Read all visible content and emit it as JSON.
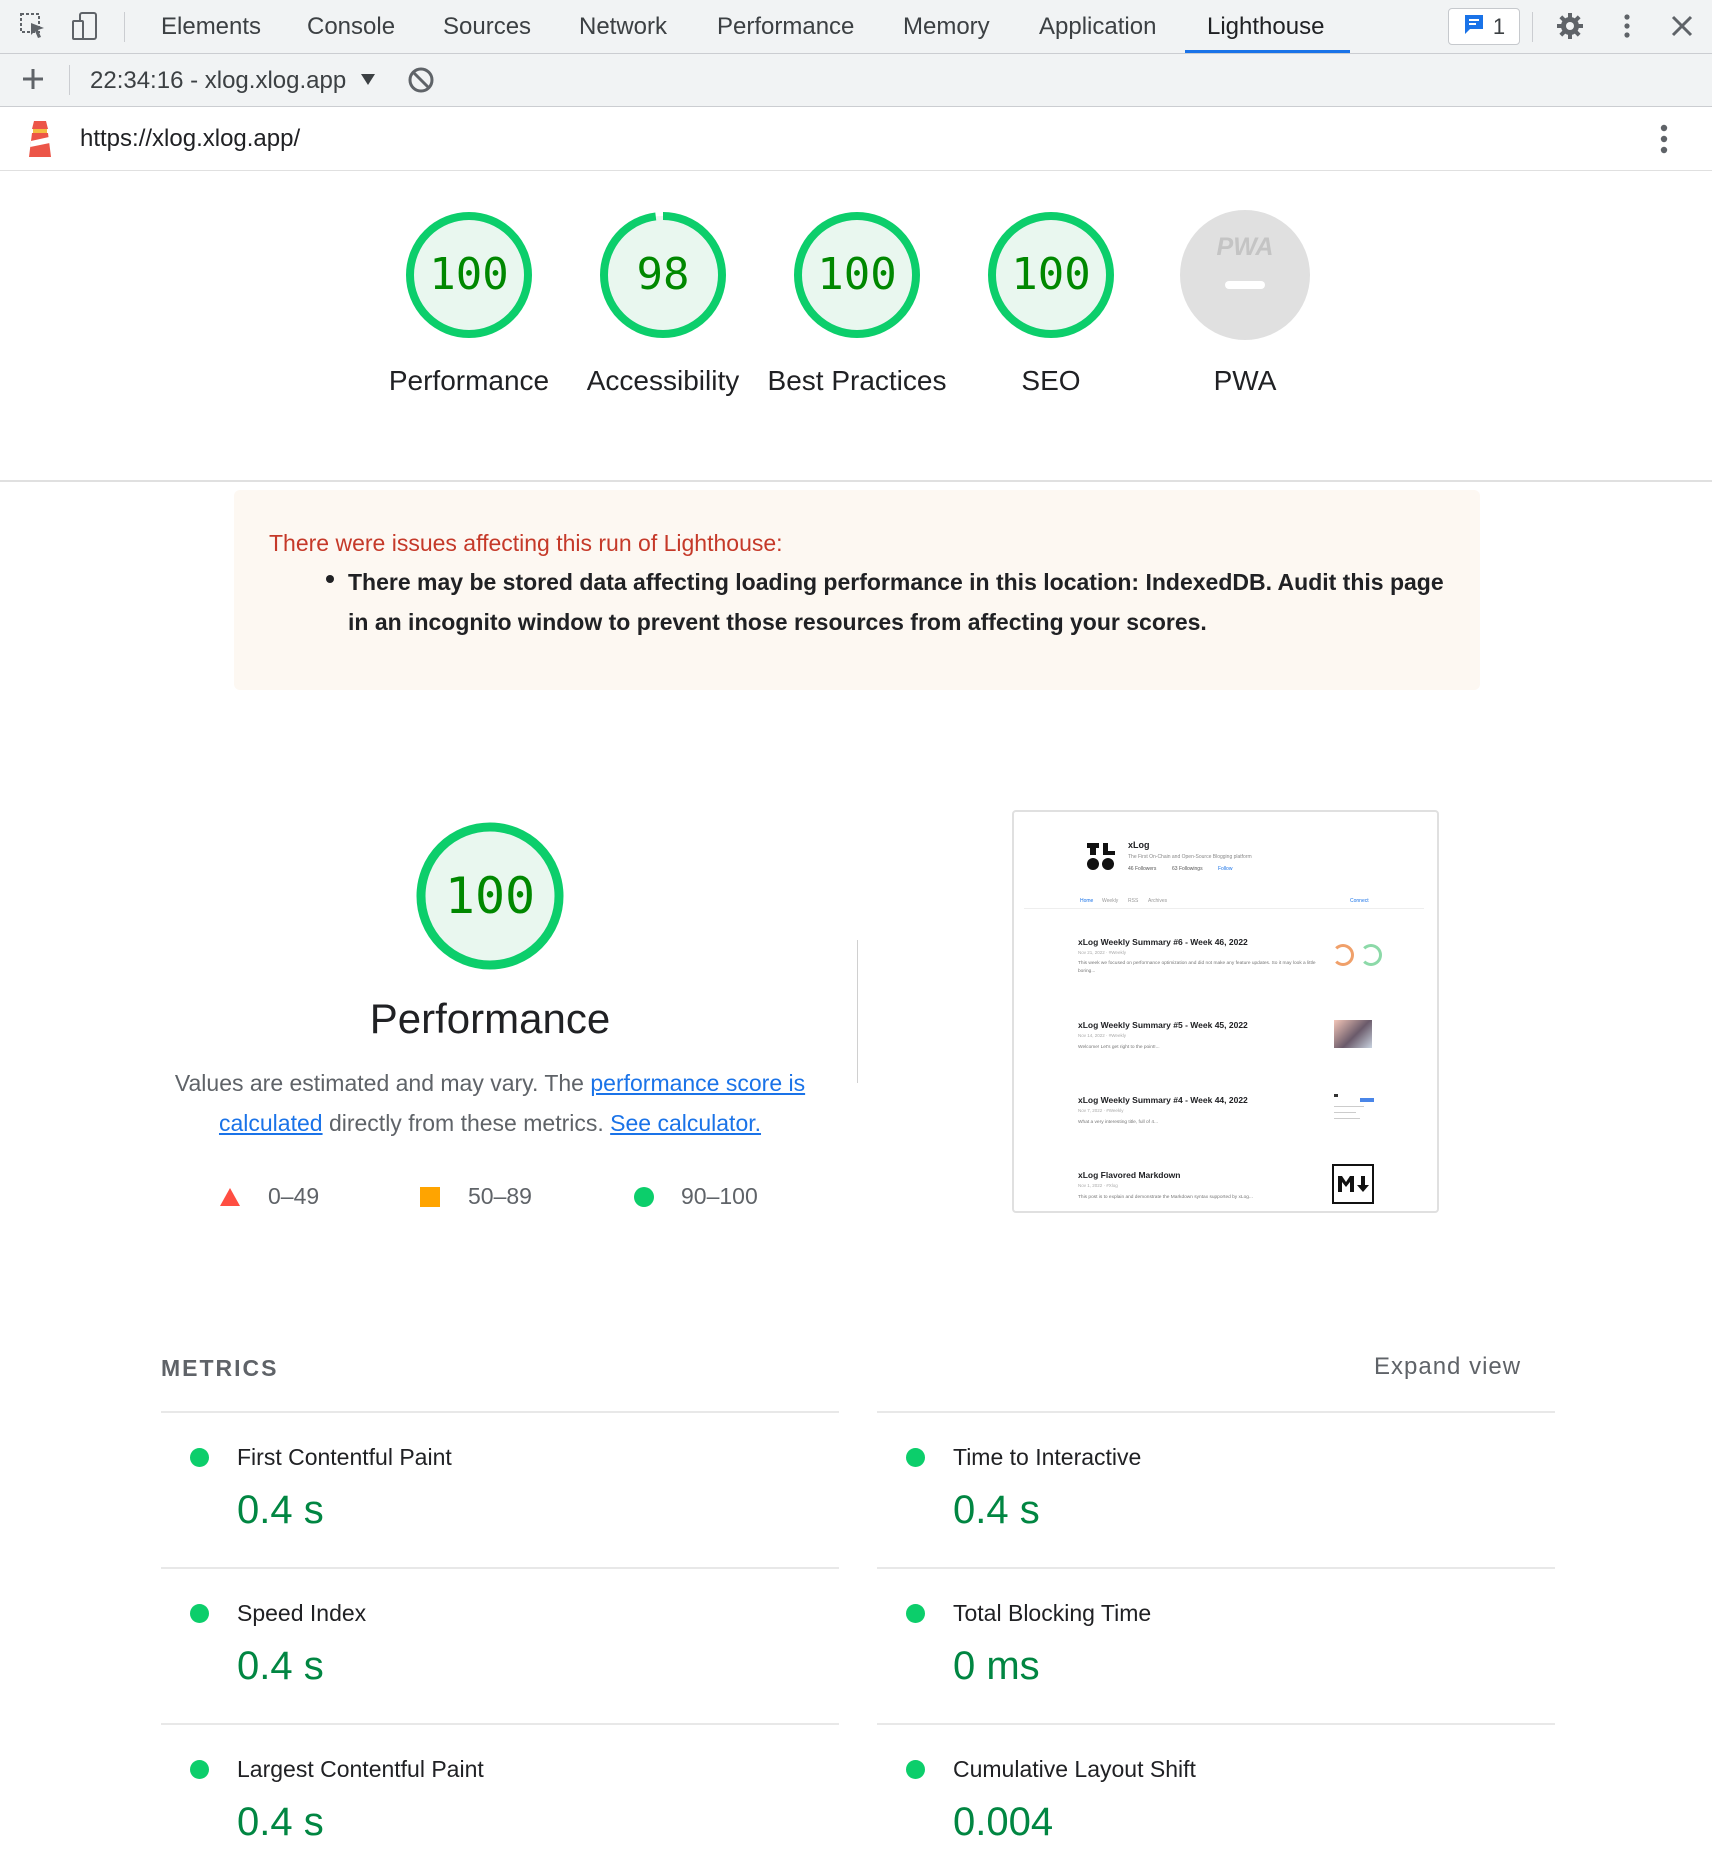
{
  "devtools": {
    "tabs": [
      "Elements",
      "Console",
      "Sources",
      "Network",
      "Performance",
      "Memory",
      "Application",
      "Lighthouse"
    ],
    "active_tab": "Lighthouse",
    "issues_count": "1"
  },
  "lighthouse_toolbar": {
    "report_selector": "22:34:16 - xlog.xlog.app"
  },
  "url_bar": {
    "url": "https://xlog.xlog.app/"
  },
  "scores": [
    {
      "label": "Performance",
      "value": "100",
      "score": 100
    },
    {
      "label": "Accessibility",
      "value": "98",
      "score": 98
    },
    {
      "label": "Best Practices",
      "value": "100",
      "score": 100
    },
    {
      "label": "SEO",
      "value": "100",
      "score": 100
    },
    {
      "label": "PWA",
      "badge": "PWA"
    }
  ],
  "warning": {
    "title": "There were issues affecting this run of Lighthouse:",
    "items": [
      "There may be stored data affecting loading performance in this location: IndexedDB. Audit this page in an incognito window to prevent those resources from affecting your scores."
    ]
  },
  "performance": {
    "score": "100",
    "title": "Performance",
    "desc_prefix": "Values are estimated and may vary. The ",
    "desc_link1": "performance score is calculated",
    "desc_middle": " directly from these metrics. ",
    "desc_link2": "See calculator.",
    "legend": [
      "0–49",
      "50–89",
      "90–100"
    ]
  },
  "screenshot": {
    "site_name": "xLog",
    "site_desc": "The First On-Chain and Open-Source Blogging platform",
    "followers": "46 Followers",
    "followings": "63 Followings",
    "follow": "Follow",
    "nav": [
      "Home",
      "Weekly",
      "RSS",
      "Archives"
    ],
    "connect": "Connect",
    "posts": [
      {
        "title": "xLog Weekly Summary #6 - Week 46, 2022",
        "meta": "Nov 21, 2022 · #Weekly",
        "excerpt": "This week we focused on performance optimization and did not make any feature updates. So it may look a little boring..."
      },
      {
        "title": "xLog Weekly Summary #5 - Week 45, 2022",
        "meta": "Nov 14, 2022 · #Weekly",
        "excerpt": "Welcome! Let's get right to the point!..."
      },
      {
        "title": "xLog Weekly Summary #4 - Week 44, 2022",
        "meta": "Nov 7, 2022 · #Weekly",
        "excerpt": "What a very interesting title, full of 4..."
      },
      {
        "title": "xLog Flavored Markdown",
        "meta": "Nov 1, 2022 · #Xlog",
        "excerpt": "This post is to explain and demonstrate the Markdown syntax supported by xLog..."
      }
    ]
  },
  "metrics": {
    "header": "METRICS",
    "expand": "Expand view",
    "items": [
      {
        "name": "First Contentful Paint",
        "value": "0.4 s",
        "status": "pass"
      },
      {
        "name": "Time to Interactive",
        "value": "0.4 s",
        "status": "pass"
      },
      {
        "name": "Speed Index",
        "value": "0.4 s",
        "status": "pass"
      },
      {
        "name": "Total Blocking Time",
        "value": "0 ms",
        "status": "pass"
      },
      {
        "name": "Largest Contentful Paint",
        "value": "0.4 s",
        "status": "pass"
      },
      {
        "name": "Cumulative Layout Shift",
        "value": "0.004",
        "status": "pass"
      }
    ]
  },
  "colors": {
    "pass": "#0cce6b",
    "pass_text": "#008800",
    "average": "#ffa400",
    "fail": "#ff4e42",
    "accent": "#1a73e8",
    "warning_text": "#c53929"
  }
}
